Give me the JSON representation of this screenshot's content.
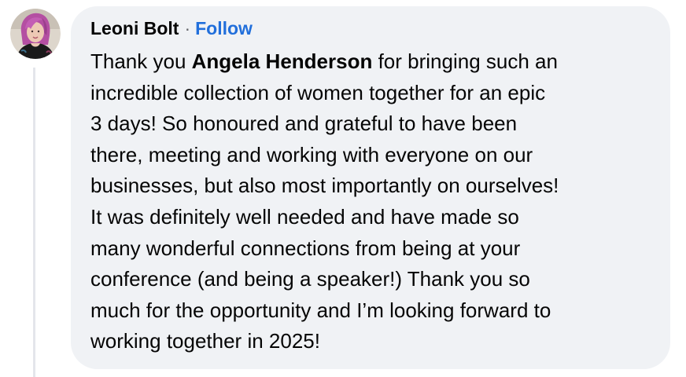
{
  "comment": {
    "author": "Leoni Bolt",
    "separator": "·",
    "follow_label": "Follow",
    "text": {
      "line1_before": "Thank you ",
      "mention": "Angela Henderson",
      "line1_after": " for bringing such an",
      "lines": [
        "incredible collection of women together for an epic",
        "3 days! So honoured and grateful to have been",
        "there, meeting and working with everyone on our",
        "businesses, but also most importantly on ourselves!",
        "It was definitely well needed and have made so",
        "many wonderful connections from being at your",
        "conference (and being a speaker!) Thank you so",
        "much for the opportunity and I’m looking forward to",
        "working together in 2025!"
      ]
    }
  },
  "colors": {
    "bubble_background": "#f0f2f5",
    "text": "#050505",
    "follow_link": "#216fdb",
    "secondary_text": "#65676b",
    "thread_line": "#e4e6eb"
  },
  "icons": {
    "avatar": "profile-photo-avatar"
  }
}
